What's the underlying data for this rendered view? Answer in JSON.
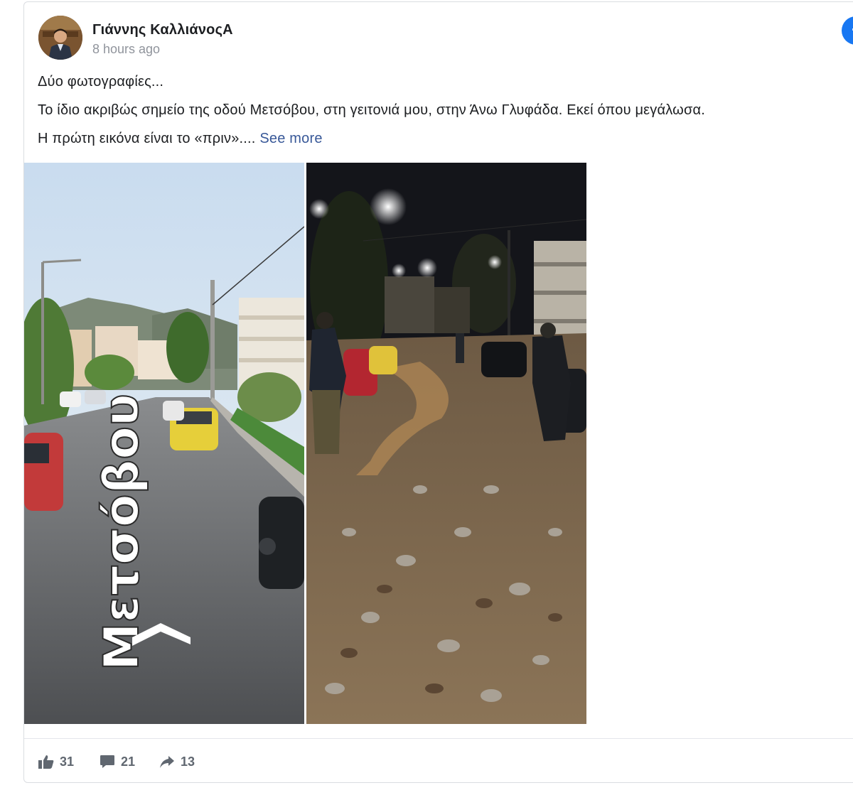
{
  "post": {
    "author": "Γιάννης ΚαλλιάνοςA",
    "timestamp": "8 hours ago",
    "lines": [
      "Δύο φωτογραφίες...",
      "Το ίδιο ακριβώς σημείο της οδού Μετσόβου, στη γειτονιά μου, στην Άνω Γλυφάδα. Εκεί όπου μεγάλωσα.",
      "Η πρώτη εικόνα είναι το «πριν»...."
    ],
    "see_more_label": "See more",
    "street_label": "Μετσόβου",
    "platform_icon": "facebook-icon"
  },
  "stats": {
    "likes": "31",
    "comments": "21",
    "shares": "13"
  },
  "colors": {
    "link": "#385898",
    "facebook_blue": "#1877f2",
    "muted": "#606770"
  }
}
